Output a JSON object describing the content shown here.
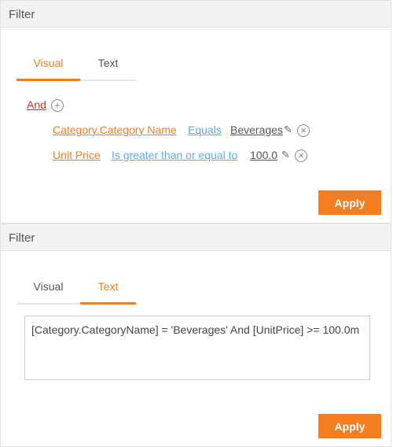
{
  "panels": [
    {
      "title": "Filter",
      "tabs": [
        "Visual",
        "Text"
      ],
      "active_tab": "Visual",
      "apply": "Apply",
      "group_op": "And",
      "conditions": [
        {
          "field": "Category.Category Name",
          "operator": "Equals",
          "value": "Beverages"
        },
        {
          "field": "Unit Price",
          "operator": "Is greater than or equal to",
          "value": "100.0"
        }
      ]
    },
    {
      "title": "Filter",
      "tabs": [
        "Visual",
        "Text"
      ],
      "active_tab": "Text",
      "apply": "Apply",
      "expression": "[Category.CategoryName] = 'Beverages' And [UnitPrice] >= 100.0m"
    }
  ],
  "colors": {
    "accent": "#f47d20",
    "group": "#d9331c",
    "operator": "#5aabf0"
  }
}
